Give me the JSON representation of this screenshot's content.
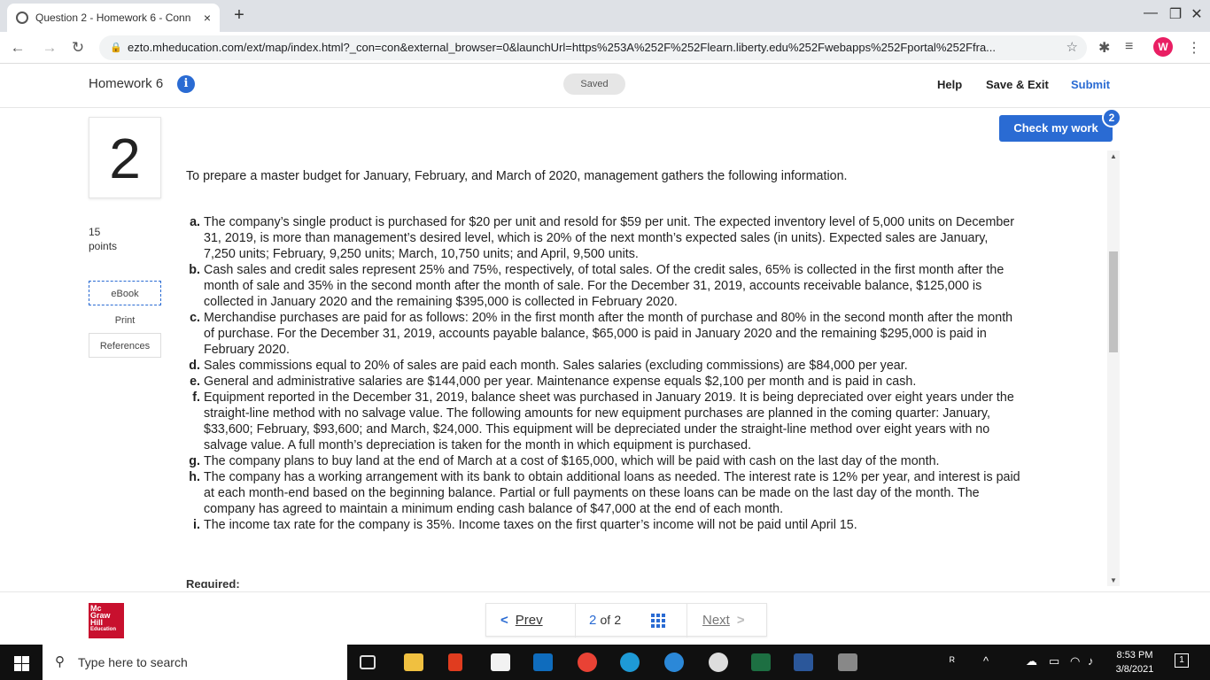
{
  "browser": {
    "tab_title": "Question 2 - Homework 6 - Conn",
    "tab_close": "×",
    "new_tab": "+",
    "url": "ezto.mheducation.com/ext/map/index.html?_con=con&external_browser=0&launchUrl=https%253A%252F%252Flearn.liberty.edu%252Fwebapps%252Fportal%252Ffra...",
    "profile_letter": "W",
    "minimize": "—",
    "maximize": "❐",
    "close": "✕"
  },
  "header": {
    "title": "Homework 6",
    "info_glyph": "i",
    "status": "Saved",
    "help": "Help",
    "save_exit": "Save & Exit",
    "submit": "Submit"
  },
  "question": {
    "number": "2",
    "points_value": "15",
    "points_label": "points",
    "ebook": "eBook",
    "print": "Print",
    "references": "References",
    "check_label": "Check my work",
    "check_badge": "2",
    "intro": "To prepare a master budget for January, February, and March of 2020, management gathers the following information.",
    "items": [
      {
        "label": "a.",
        "text": "The company’s single product is purchased for $20 per unit and resold for $59 per unit. The expected inventory level of 5,000 units on December 31, 2019, is more than management’s desired level, which is 20% of the next month’s expected sales (in units). Expected sales are January, 7,250 units; February, 9,250 units; March, 10,750 units; and April, 9,500 units."
      },
      {
        "label": "b.",
        "text": "Cash sales and credit sales represent 25% and 75%, respectively, of total sales. Of the credit sales, 65% is collected in the first month after the month of sale and 35% in the second month after the month of sale. For the December 31, 2019, accounts receivable balance, $125,000 is collected in January 2020 and the remaining $395,000 is collected in February 2020."
      },
      {
        "label": "c.",
        "text": "Merchandise purchases are paid for as follows: 20% in the first month after the month of purchase and 80% in the second month after the month of purchase. For the December 31, 2019, accounts payable balance, $65,000 is paid in January 2020 and the remaining $295,000 is paid in February 2020."
      },
      {
        "label": "d.",
        "text": "Sales commissions equal to 20% of sales are paid each month. Sales salaries (excluding commissions) are $84,000 per year."
      },
      {
        "label": "e.",
        "text": "General and administrative salaries are $144,000 per year. Maintenance expense equals $2,100 per month and is paid in cash."
      },
      {
        "label": "f.",
        "text": "Equipment reported in the December 31, 2019, balance sheet was purchased in January 2019. It is being depreciated over eight years under the straight-line method with no salvage value. The following amounts for new equipment purchases are planned in the coming quarter: January, $33,600; February, $93,600; and March, $24,000. This equipment will be depreciated under the straight-line method over eight years with no salvage value. A full month’s depreciation is taken for the month in which equipment is purchased."
      },
      {
        "label": "g.",
        "text": "The company plans to buy land at the end of March at a cost of $165,000, which will be paid with cash on the last day of the month."
      },
      {
        "label": "h.",
        "text": "The company has a working arrangement with its bank to obtain additional loans as needed. The interest rate is 12% per year, and interest is paid at each month-end based on the beginning balance. Partial or full payments on these loans can be made on the last day of the month. The company has agreed to maintain a minimum ending cash balance of $47,000 at the end of each month."
      },
      {
        "label": "i.",
        "text": "The income tax rate for the company is 35%. Income taxes on the first quarter’s income will not be paid until April 15."
      }
    ],
    "required_label": "Required:"
  },
  "footer": {
    "logo_lines": [
      "Mc",
      "Graw",
      "Hill",
      "Education"
    ],
    "prev": "Prev",
    "current_page": "2",
    "of_label": "of",
    "total_pages": "2",
    "next": "Next"
  },
  "taskbar": {
    "search_placeholder": "Type here to search",
    "time": "8:53 PM",
    "date": "3/8/2021",
    "notification_count": "1"
  },
  "colors": {
    "accent": "#2a6bd3",
    "brand_red": "#c8102e"
  }
}
